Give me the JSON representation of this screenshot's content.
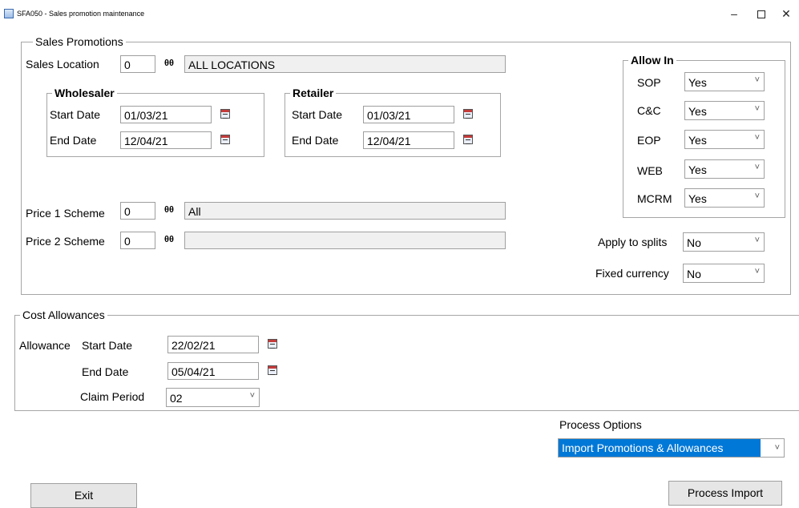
{
  "window": {
    "title": "SFA050 - Sales promotion maintenance",
    "min_glyph": "–",
    "close_glyph": "✕"
  },
  "sales_promotions": {
    "legend": "Sales Promotions",
    "sales_location_label": "Sales Location",
    "sales_location_code": "0",
    "sales_location_desc": "ALL LOCATIONS",
    "wholesaler": {
      "legend": "Wholesaler",
      "start_label": "Start Date",
      "start_value": "01/03/21",
      "end_label": "End Date",
      "end_value": "12/04/21"
    },
    "retailer": {
      "legend": "Retailer",
      "start_label": "Start Date",
      "start_value": "01/03/21",
      "end_label": "End Date",
      "end_value": "12/04/21"
    },
    "price1_label": "Price 1 Scheme",
    "price1_code": "0",
    "price1_desc": "All",
    "price2_label": "Price 2 Scheme",
    "price2_code": "0",
    "price2_desc": "",
    "allow_in": {
      "legend": "Allow In",
      "items": [
        {
          "label": "SOP",
          "value": "Yes"
        },
        {
          "label": "C&C",
          "value": "Yes"
        },
        {
          "label": "EOP",
          "value": "Yes"
        },
        {
          "label": "WEB",
          "value": "Yes"
        },
        {
          "label": "MCRM",
          "value": "Yes"
        }
      ]
    },
    "apply_to_splits_label": "Apply to splits",
    "apply_to_splits_value": "No",
    "fixed_currency_label": "Fixed currency",
    "fixed_currency_value": "No"
  },
  "cost_allowances": {
    "legend": "Cost Allowances",
    "allowance_label": "Allowance",
    "start_label": "Start Date",
    "start_value": "22/02/21",
    "end_label": "End Date",
    "end_value": "05/04/21",
    "claim_label": "Claim Period",
    "claim_value": "02"
  },
  "process": {
    "options_label": "Process Options",
    "selected_option": "Import Promotions & Allowances"
  },
  "buttons": {
    "exit": "Exit",
    "process_import": "Process Import"
  },
  "icons": {
    "lookup": "binoculars-icon",
    "calendar": "calendar-icon",
    "dropdown": "chevron-down-icon",
    "binoc_glyph": "θθ",
    "chevron_glyph": "˅"
  },
  "colors": {
    "selection": "#0078d7",
    "border": "#a6a6a6",
    "readonly_bg": "#f0f0f0"
  }
}
